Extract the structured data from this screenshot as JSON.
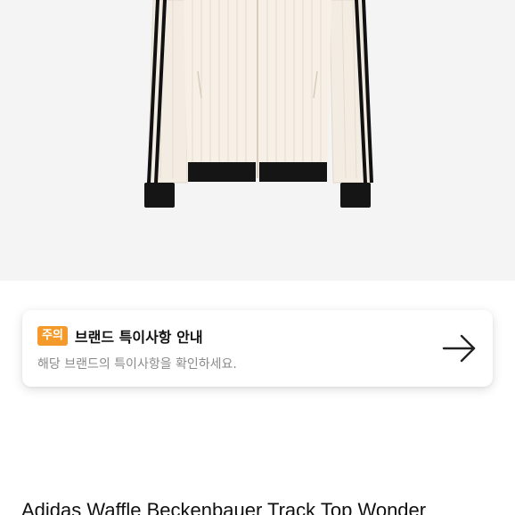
{
  "notice": {
    "badge": "주의",
    "title": "브랜드 특이사항 안내",
    "description": "해당 브랜드의 특이사항을 확인하세요.",
    "action_icon": "arrow-right-icon"
  },
  "product": {
    "title": "Adidas Waffle Beckenbauer Track Top Wonder"
  },
  "colors": {
    "badge_bg": "#f39a2a",
    "image_bg": "#f4f4f4",
    "jacket_body": "#f3ece2",
    "jacket_trim": "#111111"
  }
}
